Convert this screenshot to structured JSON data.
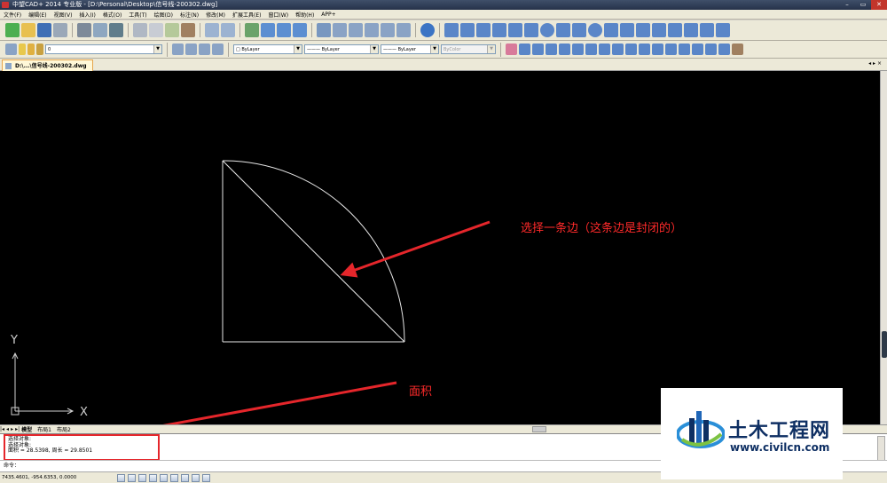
{
  "window": {
    "title": "中望CAD+ 2014 专业版 - [D:\\Personal\\Desktop\\信号线-200302.dwg]",
    "minimize": "–",
    "restore": "▭",
    "close": "✕"
  },
  "menu": [
    "文件(F)",
    "编辑(E)",
    "视图(V)",
    "插入(I)",
    "格式(O)",
    "工具(T)",
    "绘图(D)",
    "标注(N)",
    "修改(M)",
    "扩展工具(E)",
    "窗口(W)",
    "帮助(H)",
    "APP+"
  ],
  "toolbar2": {
    "layer": "0",
    "color": "ByLayer",
    "linetype": "——— ByLayer",
    "lineweight": "——— ByLayer",
    "plotstyle": "ByColor"
  },
  "doc_tab": {
    "label": "D:\\...\\信号线-200302.dwg",
    "nav": "◂ ▸ ×"
  },
  "ucs": {
    "x_label": "X",
    "y_label": "Y"
  },
  "annotations": {
    "edge_note": "选择一条边（这条边是封闭的）",
    "area_note": "面积"
  },
  "layout_tabs": {
    "nav": [
      "|◂",
      "◂",
      "▸",
      "▸|"
    ],
    "model": "模型",
    "layout1": "布局1",
    "layout2": "布局2"
  },
  "command_history": [
    "选择对象:",
    "选择对象:",
    "面积 = 28.5398, 周长 = 29.8501"
  ],
  "command_prompt": "命令：",
  "status": {
    "coords": "7435.4601, -954.6353, 0.0000"
  },
  "watermark": {
    "title": "土木工程网",
    "url": "www.civilcn.com"
  },
  "colors": {
    "annotation": "#e5262b",
    "canvas": "#000000",
    "watermark_blue": "#0e2f63"
  }
}
